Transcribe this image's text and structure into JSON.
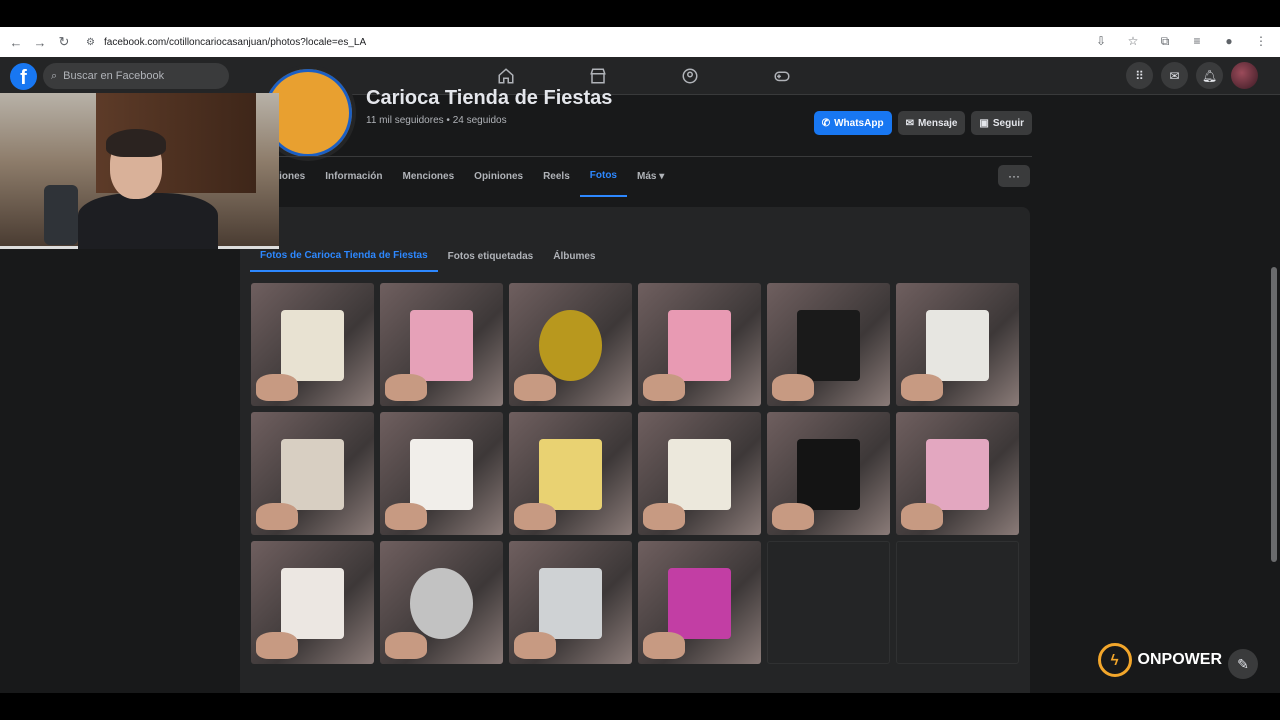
{
  "browser": {
    "url": "facebook.com/cotilloncariocasanjuan/photos?locale=es_LA"
  },
  "fb": {
    "logo": "f",
    "search_placeholder": "Buscar en Facebook",
    "nav_icons": [
      "home-icon",
      "marketplace-icon",
      "groups-icon",
      "gaming-icon"
    ],
    "right_icons": [
      "menu-grid-icon",
      "messenger-icon",
      "notifications-icon"
    ]
  },
  "page": {
    "name": "Carioca Tienda de Fiestas",
    "followers": "11 mil seguidores • 24 seguidos",
    "buttons": {
      "whatsapp": "WhatsApp",
      "message": "Mensaje",
      "follow": "Seguir"
    },
    "tabs": [
      "aciones",
      "Información",
      "Menciones",
      "Opiniones",
      "Reels",
      "Fotos",
      "Más ▾"
    ],
    "active_tab": "Fotos",
    "more": "···"
  },
  "photos": {
    "title": "s",
    "sub_tabs": [
      "Fotos de Carioca Tienda de Fiestas",
      "Fotos etiquetadas",
      "Álbumes"
    ],
    "active_sub_tab": "Fotos de Carioca Tienda de Fiestas"
  },
  "watermark": {
    "text": "ONPOWER"
  }
}
